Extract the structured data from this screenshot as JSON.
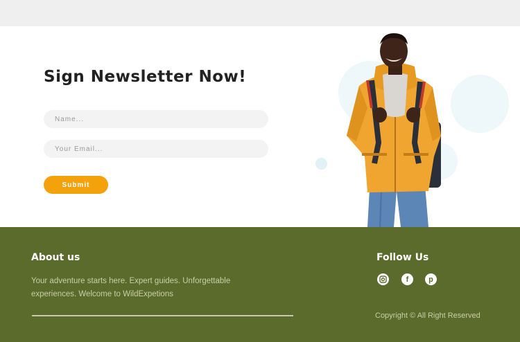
{
  "newsletter": {
    "title": "Sign Newsletter Now!",
    "name_placeholder": "Name...",
    "email_placeholder": "Your Email...",
    "submit_label": "Submit",
    "accent_color": "#f4a20c"
  },
  "footer": {
    "about_title": "About us",
    "about_text": "Your adventure starts here. Expert guides. Unforgettable experiences. Welcome to WildExpetions",
    "follow_title": "Follow Us",
    "social_icons": [
      "instagram-icon",
      "facebook-icon",
      "pinterest-icon"
    ],
    "copyright": "Copyright © All Right Reserved",
    "background_color": "#5a6b2c"
  }
}
